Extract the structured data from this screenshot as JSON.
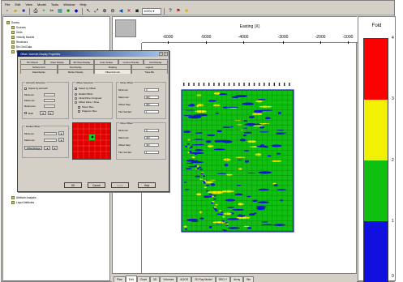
{
  "menu": [
    "File",
    "Edit",
    "View",
    "Model",
    "Tools",
    "Window",
    "Help"
  ],
  "toolbar": {
    "zoom": "100%",
    "icons": [
      "new-icon",
      "open-icon",
      "save-icon",
      "print-icon",
      "add-icon",
      "cut-icon",
      "chart-icon",
      "color-icon",
      "settings-icon",
      "pointer-icon",
      "pan-icon",
      "zoom-in-icon",
      "zoom-out-icon",
      "measure-icon",
      "close-icon",
      "info-icon",
      "help-icon",
      "flag-icon",
      "highlight-icon"
    ]
  },
  "tree": {
    "items": [
      {
        "label": "Survey",
        "depth": 0
      },
      {
        "label": "Sources",
        "depth": 1
      },
      {
        "label": "Grids",
        "depth": 1
      },
      {
        "label": "Velocity Models",
        "depth": 1
      },
      {
        "label": "Receivers",
        "depth": 1
      },
      {
        "label": "Bin Grid Data",
        "depth": 1
      },
      {
        "label": "Fold Maps",
        "depth": 1
      },
      {
        "label": "Attribute Analysis",
        "depth": 0
      },
      {
        "label": "Layer Attributes",
        "depth": 0
      }
    ]
  },
  "viewport": {
    "axis_title": "Easting (X)",
    "x_ticks": [
      "-6000",
      "-5000",
      "-4000",
      "-3000",
      "-2000",
      "-1000"
    ]
  },
  "chart_data": {
    "type": "heatmap",
    "title": "Fold",
    "xlabel": "Easting (X)",
    "x_ticks": [
      -6000,
      -5000,
      -4000,
      -3000,
      -2000,
      -1000
    ],
    "color_scale": {
      "min": 0,
      "max": 4,
      "ticks": [
        0,
        1,
        2,
        3,
        4
      ],
      "bands": [
        {
          "from": 0,
          "to": 1,
          "color": "#1010e0"
        },
        {
          "from": 1,
          "to": 2,
          "color": "#10c010"
        },
        {
          "from": 2,
          "to": 3,
          "color": "#f0f000"
        },
        {
          "from": 3,
          "to": 4,
          "color": "#ff0000"
        }
      ]
    },
    "dominant_value_range": [
      1,
      2
    ],
    "grid": true
  },
  "legend": {
    "title": "Fold",
    "ticks": [
      "4",
      "3",
      "2",
      "1",
      "0"
    ]
  },
  "tabs": [
    {
      "label": "Plan",
      "active": false
    },
    {
      "label": "Edit",
      "active": true
    },
    {
      "label": "Chart",
      "active": false
    },
    {
      "label": "3D",
      "active": false
    },
    {
      "label": "Volumes",
      "active": false
    },
    {
      "label": "AOGS",
      "active": false
    },
    {
      "label": "2D Ray Model",
      "active": false
    },
    {
      "label": "SEG-Y",
      "active": false
    },
    {
      "label": "Array",
      "active": false
    },
    {
      "label": "Bin",
      "active": false
    }
  ],
  "dialog": {
    "title": "Offset / Azimuth Display Properties",
    "tabs_row1": [
      "Bin Sheets",
      "Chart Display",
      "3D Chart Display",
      "Color Scales",
      "Contour Display",
      "Grid Display"
    ],
    "tabs_row2": [
      "Surface Grid",
      "Pop Display",
      "Shading",
      "Legend"
    ],
    "tabs_row3": [
      "Data Display",
      "Marker Display",
      "Offset/Azimuth",
      "Trace Bin"
    ],
    "azimuth": {
      "title": "Azimuth Selection",
      "all_label": "Select by Azimuth",
      "minimum_label": "Minimum",
      "maximum_label": "Maximum",
      "reference_label": "Reference",
      "both_label": "Both"
    },
    "offset_sel": {
      "title": "Offset Selection",
      "by_offset_label": "Select by Offset",
      "radial_label": "Radial Offset",
      "inline_label": "Inline/Xline Unsigned",
      "offset_inline_label": "Offset Inline / Xline",
      "show_tiles_label": "Show Tiles",
      "diagram_label": "Diagram Tiles"
    },
    "inline_offset": {
      "title": "Inline Offset",
      "minimum_label": "Minimum",
      "minimum_value": "0",
      "maximum_label": "Maximum",
      "maximum_value": "400",
      "step_label": "Offset Step",
      "step_value": "400",
      "number_label": "Tile Number",
      "number_value": "1"
    },
    "xline_offset": {
      "title": "Xline Offset",
      "minimum_label": "Minimum",
      "minimum_value": "0",
      "maximum_label": "Maximum",
      "maximum_value": "400",
      "step_label": "Offset Step",
      "step_value": "400",
      "number_label": "Tile Number",
      "number_value": "1"
    },
    "radial": {
      "title": "Radial Offset",
      "minimum_label": "Minimum",
      "maximum_label": "Maximum",
      "offset_range_label": "Offset Range"
    },
    "buttons": {
      "ok": "OK",
      "cancel": "Cancel",
      "apply": "Apply",
      "help": "Help"
    }
  }
}
